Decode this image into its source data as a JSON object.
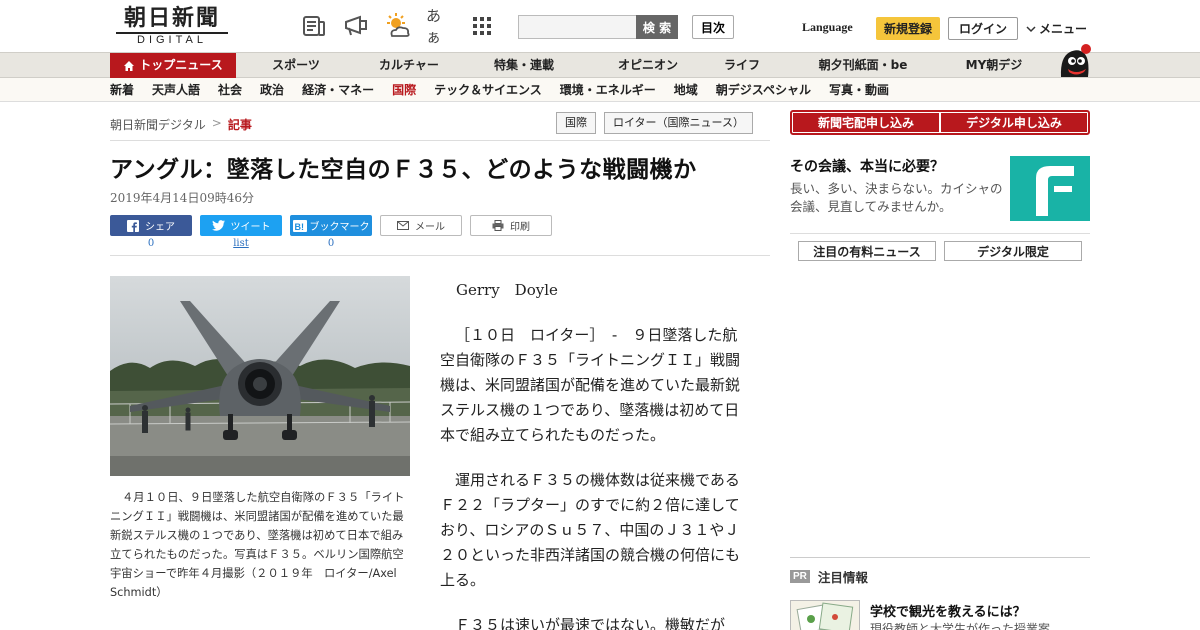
{
  "header": {
    "logo_main": "朝日新聞",
    "logo_sub": "DIGITAL",
    "icons": [
      "newspaper-icon",
      "megaphone-icon",
      "weather-icon",
      "font-size-icon",
      "grid-icon"
    ],
    "font_icon_text": "あぁ",
    "search_placeholder": "",
    "search_button": "検 索",
    "mokuji_button": "目次",
    "language": "Language",
    "register_button": "新規登録",
    "login_button": "ログイン",
    "menu_button": "メニュー"
  },
  "mainnav": {
    "items": [
      "トップニュース",
      "スポーツ",
      "カルチャー",
      "特集・連載",
      "オピニオン",
      "ライフ",
      "朝夕刊紙面・be",
      "MY朝デジ"
    ]
  },
  "subnav": {
    "items": [
      "新着",
      "天声人語",
      "社会",
      "政治",
      "経済・マネー",
      "国際",
      "テック＆サイエンス",
      "環境・エネルギー",
      "地域",
      "朝デジスペシャル",
      "写真・動画"
    ],
    "active_index": 5
  },
  "breadcrumb": {
    "home": "朝日新聞デジタル",
    "separator": ">",
    "current": "記事"
  },
  "tags": [
    "国際",
    "ロイター（国際ニュース）"
  ],
  "article": {
    "title": "アングル：墜落した空自のＦ３５、どのような戦闘機か",
    "date": "2019年4月14日09時46分",
    "share": {
      "facebook_label": "シェア",
      "facebook_count": "0",
      "twitter_label": "ツイート",
      "twitter_count": "list",
      "hatena_label": "ブックマーク",
      "hatena_count": "0",
      "mail_label": "メール",
      "print_label": "印刷"
    },
    "photo_caption": "４月１０日、９日墜落した航空自衛隊のＦ３５「ライトニングＩＩ」戦闘機は、米同盟諸国が配備を進めていた最新鋭ステルス機の１つであり、墜落機は初めて日本で組み立てられたものだった。写真はＦ３５。ベルリン国際航空宇宙ショーで昨年４月撮影（２０１９年　ロイター/Axel Schmidt）",
    "author": "Gerry　Doyle",
    "paragraphs": [
      "［１０日　ロイター］　-　９日墜落した航空自衛隊のＦ３５「ライトニングＩＩ」戦闘機は、米同盟諸国が配備を進めていた最新鋭ステルス機の１つであり、墜落機は初めて日本で組み立てられたものだった。",
      "運用されるＦ３５の機体数は従来機であるＦ２２「ラプター」のすでに約２倍に達しており、ロシアのＳｕ５７、中国のＪ３１やＪ２０といった非西洋諸国の競合機の何倍にも上る。",
      "Ｆ３５は速いが最速ではない。機敏だが"
    ]
  },
  "sidebar": {
    "top_buttons": [
      "新聞宅配申し込み",
      "デジタル申し込み"
    ],
    "promo_title": "その会議、本当に必要？",
    "promo_text": "長い、多い、決まらない。カイシャの会議、見直してみませんか。",
    "tabs": [
      "注目の有料ニュース",
      "デジタル限定"
    ],
    "pr_badge": "PR",
    "pr_title": "注目情報",
    "pr_item_title": "学校で観光を教えるには？",
    "pr_item_sub": "現役教師と大学生が作った授業案"
  },
  "colors": {
    "brand_red": "#b8181d",
    "register_yellow": "#f5c53b",
    "facebook_blue": "#3b5998",
    "twitter_blue": "#1da1f2",
    "hatena_blue": "#1f8fde",
    "promo_teal": "#19b3a6"
  }
}
